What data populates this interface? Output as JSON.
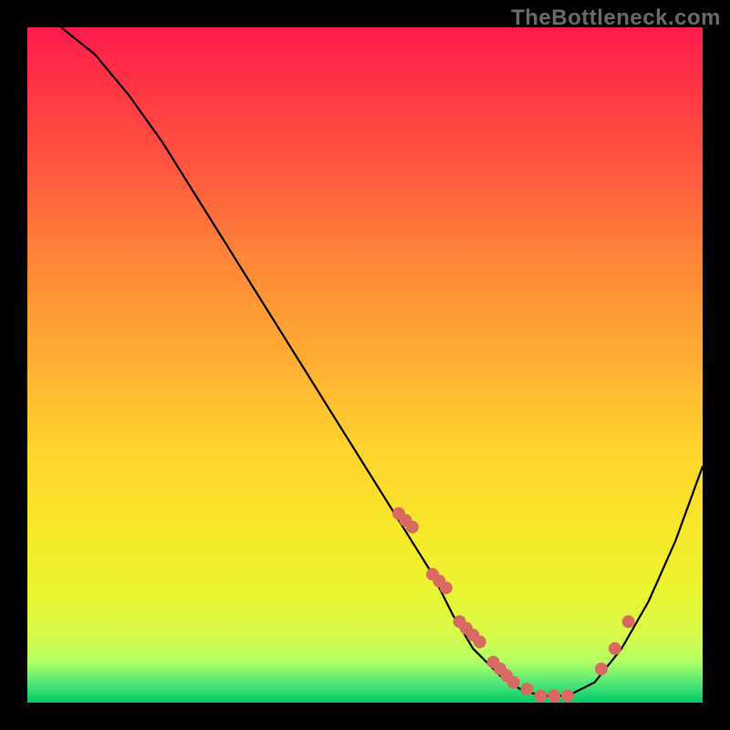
{
  "watermark": "TheBottleneck.com",
  "colors": {
    "background": "#000000",
    "gradient_top": "#ff1a4d",
    "gradient_mid": "#ffd22e",
    "gradient_bottom": "#00cc66",
    "curve_stroke": "#000000",
    "dot_fill": "#d86a62"
  },
  "chart_data": {
    "type": "line",
    "title": "",
    "xlabel": "",
    "ylabel": "",
    "xlim": [
      0,
      100
    ],
    "ylim": [
      0,
      100
    ],
    "series": [
      {
        "name": "curve",
        "x": [
          5,
          10,
          15,
          20,
          25,
          30,
          35,
          40,
          45,
          50,
          55,
          60,
          63,
          66,
          70,
          73,
          76,
          80,
          84,
          88,
          92,
          96,
          100
        ],
        "values": [
          100,
          96,
          90,
          83,
          75,
          67,
          59,
          51,
          43,
          35,
          27,
          19,
          13,
          8,
          4,
          2,
          1,
          1,
          3,
          8,
          15,
          24,
          35
        ]
      }
    ],
    "dots": {
      "name": "highlight-points",
      "x": [
        55,
        56,
        57,
        60,
        61,
        62,
        64,
        65,
        66,
        67,
        69,
        70,
        71,
        72,
        74,
        76,
        78,
        80,
        85,
        87,
        89
      ],
      "values": [
        28,
        27,
        26,
        19,
        18,
        17,
        12,
        11,
        10,
        9,
        6,
        5,
        4,
        3,
        2,
        1,
        1,
        1,
        5,
        8,
        12
      ]
    }
  }
}
